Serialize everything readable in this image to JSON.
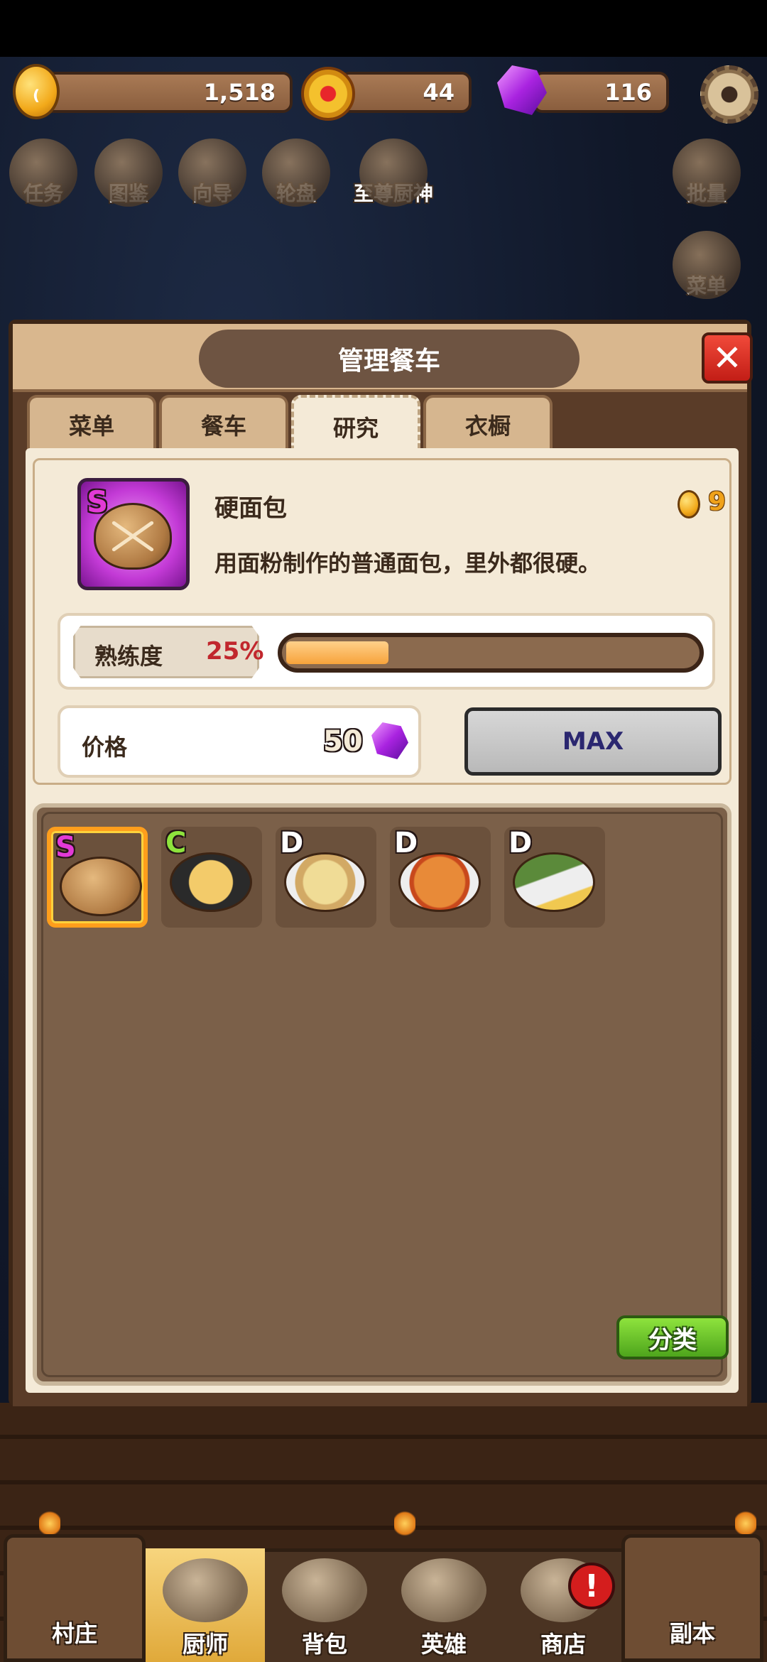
{
  "resources": {
    "coins": "1,518",
    "medals": "44",
    "gems": "116"
  },
  "top_icons": [
    {
      "label": "任务",
      "icon": "scroll-icon"
    },
    {
      "label": "图鉴",
      "icon": "book-icon"
    },
    {
      "label": "向导",
      "icon": "signpost-icon"
    },
    {
      "label": "轮盘",
      "icon": "wheel-icon"
    },
    {
      "label": "至尊厨神",
      "icon": "chef-icon"
    }
  ],
  "side_icons": [
    {
      "label": "批量",
      "icon": "bird-icon"
    },
    {
      "label": "菜单",
      "icon": "menu-board-icon"
    }
  ],
  "panel": {
    "title": "管理餐车",
    "close_symbol": "✕",
    "tabs": [
      {
        "label": "菜单",
        "active": false
      },
      {
        "label": "餐车",
        "active": false
      },
      {
        "label": "研究",
        "active": true
      },
      {
        "label": "衣橱",
        "active": false
      }
    ]
  },
  "selected_food": {
    "grade": "S",
    "name": "硬面包",
    "sell_price": "9",
    "description": "用面粉制作的普通面包，里外都很硬。",
    "proficiency_label": "熟练度",
    "proficiency_text": "25%",
    "proficiency_fraction": 0.25,
    "price_label": "价格",
    "price_value": "50",
    "max_label": "MAX"
  },
  "food_list": [
    {
      "grade": "S",
      "grade_color": "#e23ad6",
      "dish": "bread"
    },
    {
      "grade": "C",
      "grade_color": "#8ee33d",
      "dish": "soup"
    },
    {
      "grade": "D",
      "grade_color": "#ffffff",
      "dish": "quiche"
    },
    {
      "grade": "D",
      "grade_color": "#ffffff",
      "dish": "tomato-plate"
    },
    {
      "grade": "D",
      "grade_color": "#ffffff",
      "dish": "leek-plate"
    }
  ],
  "sort_label": "分类",
  "bottom_nav": {
    "left": "村庄",
    "items": [
      "厨师",
      "背包",
      "英雄",
      "商店"
    ],
    "right": "副本",
    "alert": "!"
  }
}
